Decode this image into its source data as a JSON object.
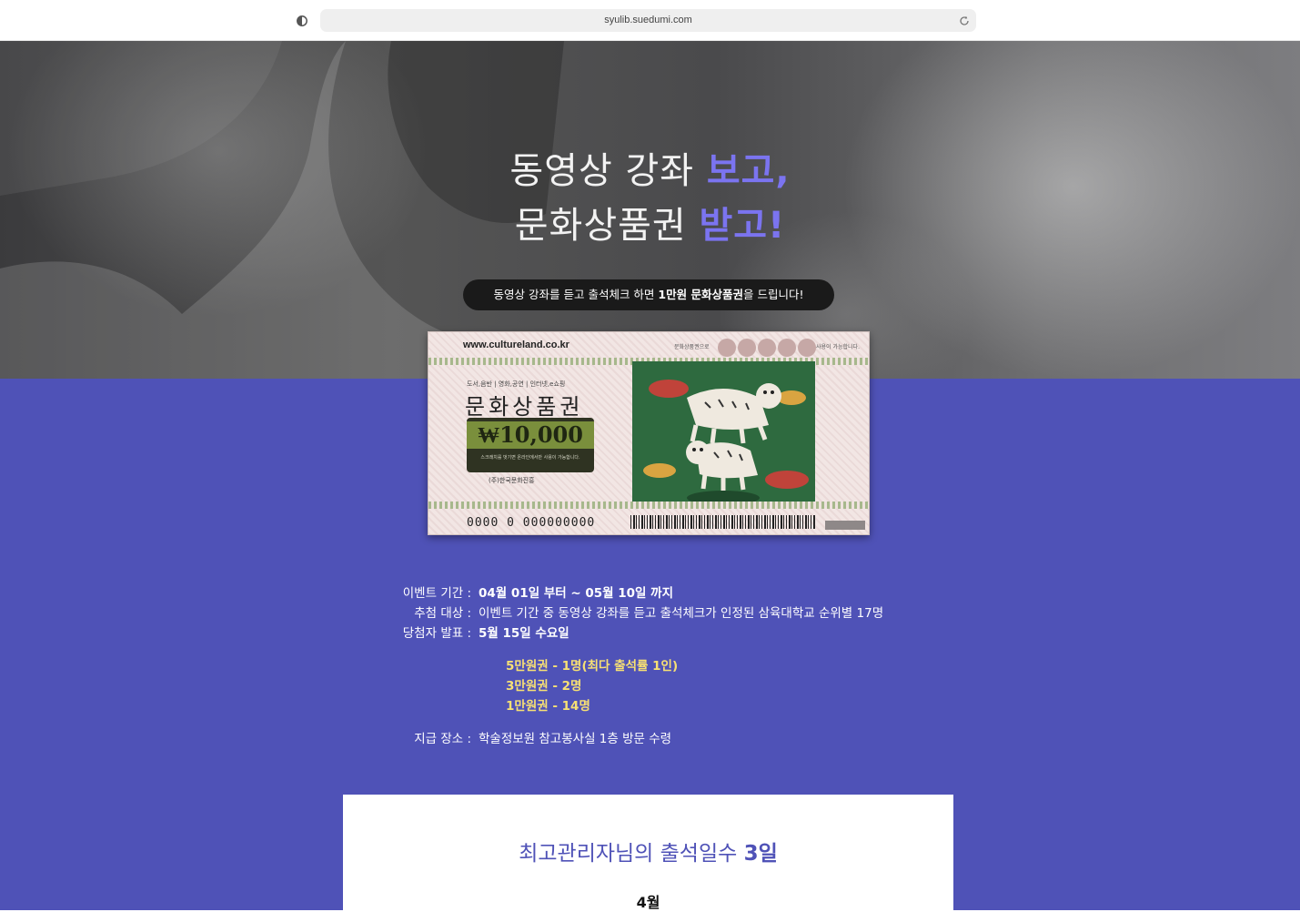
{
  "browser": {
    "url": "syulib.suedumi.com"
  },
  "hero": {
    "title_line1_normal": "동영상 강좌 ",
    "title_line1_accent": "보고,",
    "title_line2_normal": "문화상품권 ",
    "title_line2_accent": "받고!",
    "pill_prefix": "동영상 강좌를 듣고 출석체크 하면 ",
    "pill_bold": "1만원 문화상품권",
    "pill_suffix": "을 드립니다!"
  },
  "gift_card": {
    "url": "www.cultureland.co.kr",
    "top_note_left": "문화상품권으로",
    "top_note_right": "사용이 가능합니다.",
    "categories": "도서,음반 | 영화,공연 | 인터넷,e쇼핑",
    "title": "문화상품권",
    "amount": "₩10,000",
    "amount_note": "스크래치를 벗기면 온라인에서만 사용이 가능합니다.",
    "issuer": "(주)한국문화진흥",
    "number": "0000  0  000000000"
  },
  "event": {
    "period_label": "이벤트 기간 :",
    "period_value": "04월 01일 부터 ~ 05월 10일 까지",
    "target_label": "추첨 대상 :",
    "target_value": "이벤트 기간 중 동영상 강좌를 듣고 출석체크가 인정된 삼육대학교 순위별 17명",
    "announce_label": "당첨자 발표 :",
    "announce_value": "5월 15일 수요일",
    "prizes": [
      "5만원권 - 1명(최다 출석률 1인)",
      "3만원권 - 2명",
      "1만원권 - 14명"
    ],
    "place_label": "지급 장소 :",
    "place_value": "학술정보원 참고봉사실 1층 방문 수령"
  },
  "attendance": {
    "heading_prefix": "최고관리자님의 출석일수 ",
    "heading_days": "3일",
    "month": "4월"
  },
  "colors": {
    "accent": "#7b74f0",
    "purple_bg": "#4f52b7",
    "prize_yellow": "#f7e074"
  }
}
